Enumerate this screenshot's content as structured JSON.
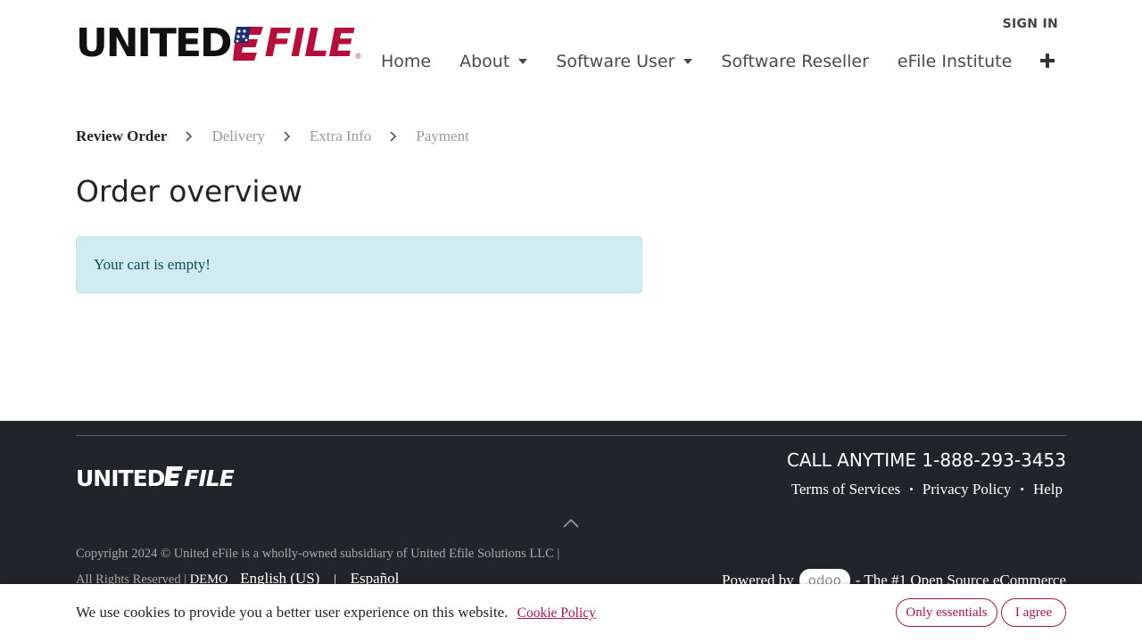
{
  "header": {
    "logo": {
      "part1": "UNITED",
      "part2": "FILE",
      "reg": "®"
    },
    "signin": "SIGN IN",
    "nav": [
      {
        "label": "Home",
        "dropdown": false
      },
      {
        "label": "About",
        "dropdown": true
      },
      {
        "label": "Software User",
        "dropdown": true
      },
      {
        "label": "Software Reseller",
        "dropdown": false
      },
      {
        "label": "eFile Institute",
        "dropdown": false
      }
    ],
    "plus_icon": "plus-icon"
  },
  "steps": [
    {
      "label": "Review Order",
      "active": true
    },
    {
      "label": "Delivery",
      "active": false
    },
    {
      "label": "Extra Info",
      "active": false
    },
    {
      "label": "Payment",
      "active": false
    }
  ],
  "page": {
    "title": "Order overview",
    "alert": "Your cart is empty!"
  },
  "footer": {
    "logo": {
      "part1": "UNITED",
      "part2": "FILE"
    },
    "call": "CALL ANYTIME 1-888-293-3453",
    "links": [
      "Terms of Services",
      "Privacy Policy",
      "Help"
    ],
    "copyright": "Copyright 2024 © United eFile is a wholly-owned subsidiary of United Efile Solutions LLC | All Rights Reserved |",
    "demo": "DEMO",
    "languages": [
      "English (US)",
      "Español"
    ],
    "powered_prefix": "Powered by",
    "powered_brand": "odoo",
    "powered_suffix": "- The #1 Open Source eCommerce"
  },
  "cookie": {
    "text": "We use cookies to provide you a better user experience on this website.",
    "policy_link": "Cookie Policy",
    "essentials_button": "Only essentials",
    "agree_button": "I agree"
  },
  "colors": {
    "brand_red": "#b5103c",
    "accent": "#a3154a",
    "footer_bg": "#212529",
    "alert_bg": "#d1ecf1"
  }
}
